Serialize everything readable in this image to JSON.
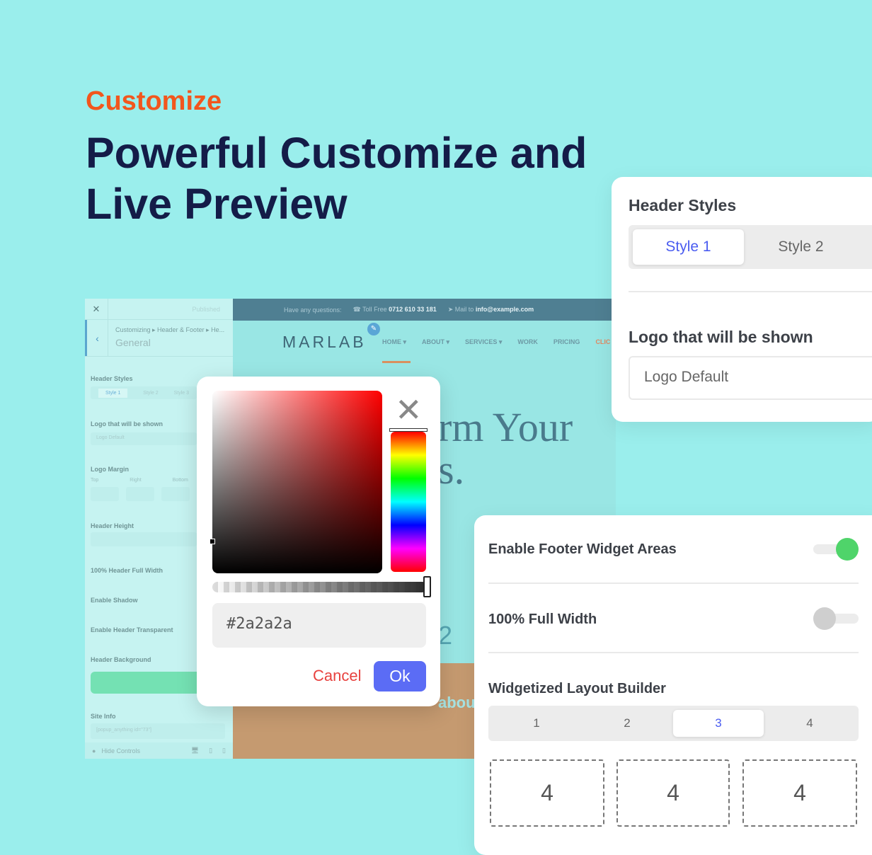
{
  "eyebrow": "Customize",
  "headline": "Powerful Customize and Live Preview",
  "customizer": {
    "published": "Published",
    "breadcrumb": "Customizing ▸ Header & Footer ▸ He...",
    "section": "General",
    "header_styles": "Header Styles",
    "styles": [
      "Style 1",
      "Style 2",
      "Style 3"
    ],
    "logo_label": "Logo that will be shown",
    "logo_value": "Logo Default",
    "logo_margin": "Logo Margin",
    "margin_fields": [
      "Top",
      "Right",
      "Bottom"
    ],
    "header_height": "Header Height",
    "full_width": "100% Header Full Width",
    "shadow": "Enable Shadow",
    "transparent": "Enable Header Transparent",
    "background": "Header Background",
    "background_color": "#6fe0b0",
    "site_info": "Site Info",
    "site_info_value": "[popup_anything id=\"73\"]",
    "hide_controls": "Hide Controls"
  },
  "preview": {
    "topbar_question": "Have any questions:",
    "toll_label": "Toll Free",
    "toll_number": "0712 610 33 181",
    "mail_label": "Mail to",
    "mail": "info@example.com",
    "logo": "MARLAB",
    "nav": [
      "HOME ▾",
      "ABOUT ▾",
      "SERVICES ▾",
      "WORK",
      "PRICING",
      "CLIC"
    ],
    "hero": "rm Your\ns.",
    "stat": "2",
    "about": "about"
  },
  "picker": {
    "hex": "#2a2a2a",
    "cancel": "Cancel",
    "ok": "Ok",
    "accent": "#5b6cf5"
  },
  "header_card": {
    "title": "Header Styles",
    "styles": [
      "Style 1",
      "Style 2"
    ],
    "selected": "Style 1",
    "logo_label": "Logo that will be shown",
    "logo_value": "Logo Default"
  },
  "footer_card": {
    "enable_widgets": "Enable Footer Widget Areas",
    "enable_widgets_on": true,
    "full_width": "100% Full Width",
    "full_width_on": false,
    "layout_title": "Widgetized Layout Builder",
    "columns": [
      "1",
      "2",
      "3",
      "4"
    ],
    "selected_columns": "3",
    "widths": [
      "4",
      "4",
      "4"
    ]
  }
}
